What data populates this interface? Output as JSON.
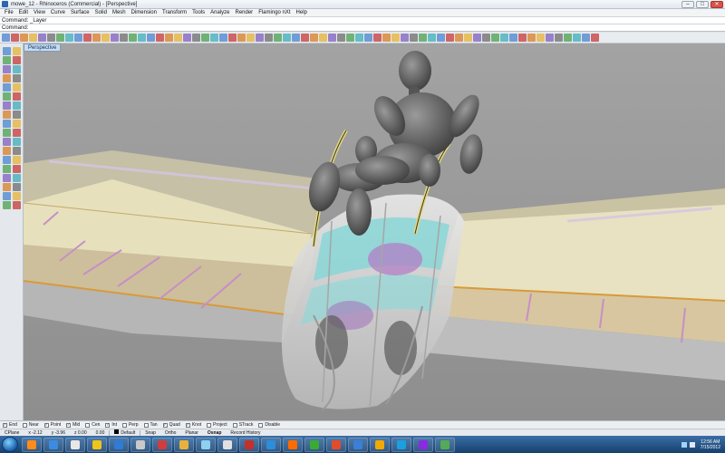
{
  "window": {
    "title": "mowe_12 - Rhinoceros (Commercial) - [Perspective]",
    "controls": [
      "–",
      "□",
      "✕"
    ]
  },
  "menu": [
    "File",
    "Edit",
    "View",
    "Curve",
    "Surface",
    "Solid",
    "Mesh",
    "Dimension",
    "Transform",
    "Tools",
    "Analyze",
    "Render",
    "Flamingo nXt",
    "Help"
  ],
  "command": {
    "history": "Command: _Layer",
    "prompt": "Command:"
  },
  "viewport": {
    "tab_label": "Perspective"
  },
  "osnaps": [
    {
      "label": "End",
      "checked": true
    },
    {
      "label": "Near",
      "checked": false
    },
    {
      "label": "Point",
      "checked": true
    },
    {
      "label": "Mid",
      "checked": true
    },
    {
      "label": "Cen",
      "checked": false
    },
    {
      "label": "Int",
      "checked": true
    },
    {
      "label": "Perp",
      "checked": false
    },
    {
      "label": "Tan",
      "checked": false
    },
    {
      "label": "Quad",
      "checked": true
    },
    {
      "label": "Knot",
      "checked": true
    },
    {
      "label": "Project",
      "checked": false
    },
    {
      "label": "STrack",
      "checked": false
    },
    {
      "label": "Disable",
      "checked": false
    }
  ],
  "status": {
    "cplane": "CPlane",
    "x": "x -2.12",
    "y": "y -3.96",
    "z": "z 0.00",
    "distance": "0.00",
    "layer": "Default",
    "toggles": [
      "Snap",
      "Ortho",
      "Planar",
      "Osnap",
      "Record History"
    ]
  },
  "clock": {
    "time": "12:56 AM",
    "date": "7/15/2012"
  },
  "colors": {
    "viewport_bg": "#9b9b9b",
    "wing_skin": "#e5dfbd",
    "wing_rib": "#d6a9d6",
    "spar_glow": "#83d9d8",
    "figure_grey": "#6f6f6f"
  }
}
